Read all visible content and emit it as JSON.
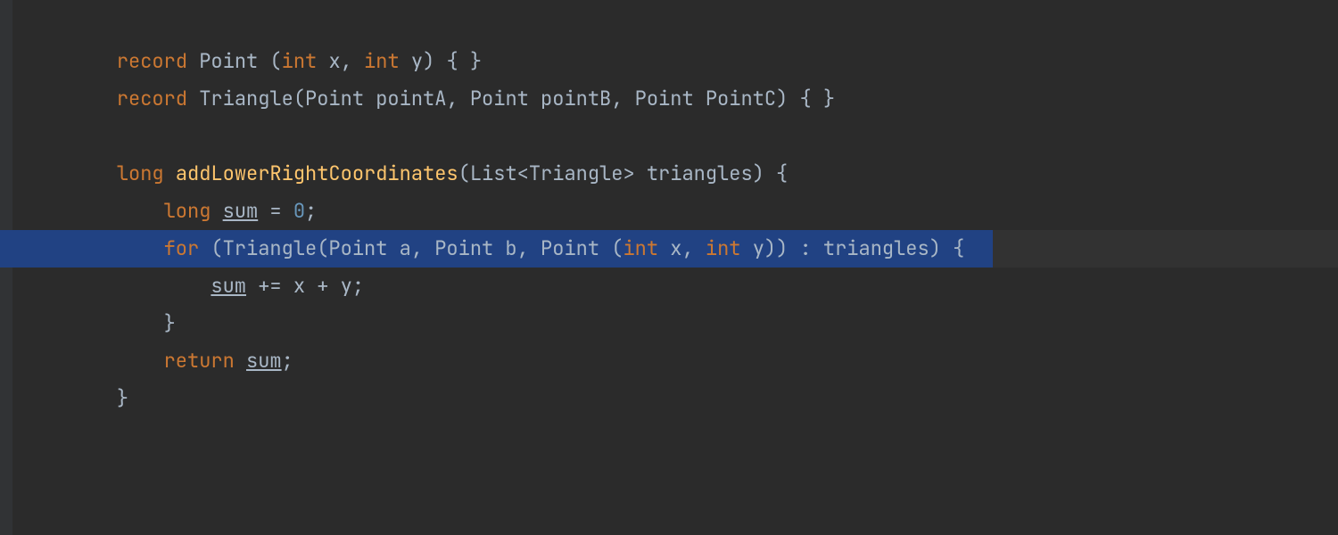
{
  "editor": {
    "lines": [
      {
        "indent": 1,
        "tokens": [
          {
            "t": "record ",
            "cls": "kw"
          },
          {
            "t": "Point ",
            "cls": "type"
          },
          {
            "t": "(",
            "cls": "plain"
          },
          {
            "t": "int ",
            "cls": "kw"
          },
          {
            "t": "x",
            "cls": "plain"
          },
          {
            "t": ", ",
            "cls": "plain"
          },
          {
            "t": "int ",
            "cls": "kw"
          },
          {
            "t": "y",
            "cls": "plain"
          },
          {
            "t": ") { }",
            "cls": "plain"
          }
        ]
      },
      {
        "indent": 1,
        "tokens": [
          {
            "t": "record ",
            "cls": "kw"
          },
          {
            "t": "Triangle",
            "cls": "type"
          },
          {
            "t": "(",
            "cls": "plain"
          },
          {
            "t": "Point pointA",
            "cls": "plain"
          },
          {
            "t": ", ",
            "cls": "plain"
          },
          {
            "t": "Point pointB",
            "cls": "plain"
          },
          {
            "t": ", ",
            "cls": "plain"
          },
          {
            "t": "Point PointC",
            "cls": "plain"
          },
          {
            "t": ") { }",
            "cls": "plain"
          }
        ]
      },
      {
        "indent": 0,
        "tokens": []
      },
      {
        "indent": 1,
        "tokens": [
          {
            "t": "long ",
            "cls": "kw"
          },
          {
            "t": "addLowerRightCoordinates",
            "cls": "fn"
          },
          {
            "t": "(",
            "cls": "plain"
          },
          {
            "t": "List<Triangle> triangles",
            "cls": "plain"
          },
          {
            "t": ") {",
            "cls": "plain"
          }
        ]
      },
      {
        "indent": 2,
        "tokens": [
          {
            "t": "long ",
            "cls": "kw"
          },
          {
            "t": "sum",
            "cls": "mut"
          },
          {
            "t": " = ",
            "cls": "plain"
          },
          {
            "t": "0",
            "cls": "lit"
          },
          {
            "t": ";",
            "cls": "plain"
          }
        ]
      },
      {
        "indent": 2,
        "highlight": true,
        "tokens": [
          {
            "t": "for ",
            "cls": "kw"
          },
          {
            "t": "(Triangle(Point a",
            "cls": "plain"
          },
          {
            "t": ", ",
            "cls": "plain"
          },
          {
            "t": "Point b",
            "cls": "plain"
          },
          {
            "t": ", ",
            "cls": "plain"
          },
          {
            "t": "Point (",
            "cls": "plain"
          },
          {
            "t": "int ",
            "cls": "kw"
          },
          {
            "t": "x",
            "cls": "plain"
          },
          {
            "t": ", ",
            "cls": "plain"
          },
          {
            "t": "int ",
            "cls": "kw"
          },
          {
            "t": "y",
            "cls": "plain"
          },
          {
            "t": ")) : triangles) {",
            "cls": "plain"
          }
        ]
      },
      {
        "indent": 3,
        "tokens": [
          {
            "t": "sum",
            "cls": "mut"
          },
          {
            "t": " += x + y;",
            "cls": "plain"
          }
        ]
      },
      {
        "indent": 2,
        "tokens": [
          {
            "t": "}",
            "cls": "plain"
          }
        ]
      },
      {
        "indent": 2,
        "tokens": [
          {
            "t": "return ",
            "cls": "kw"
          },
          {
            "t": "sum",
            "cls": "mut"
          },
          {
            "t": ";",
            "cls": "plain"
          }
        ]
      },
      {
        "indent": 1,
        "tokens": [
          {
            "t": "}",
            "cls": "plain"
          }
        ]
      }
    ],
    "indent_unit": "    "
  }
}
